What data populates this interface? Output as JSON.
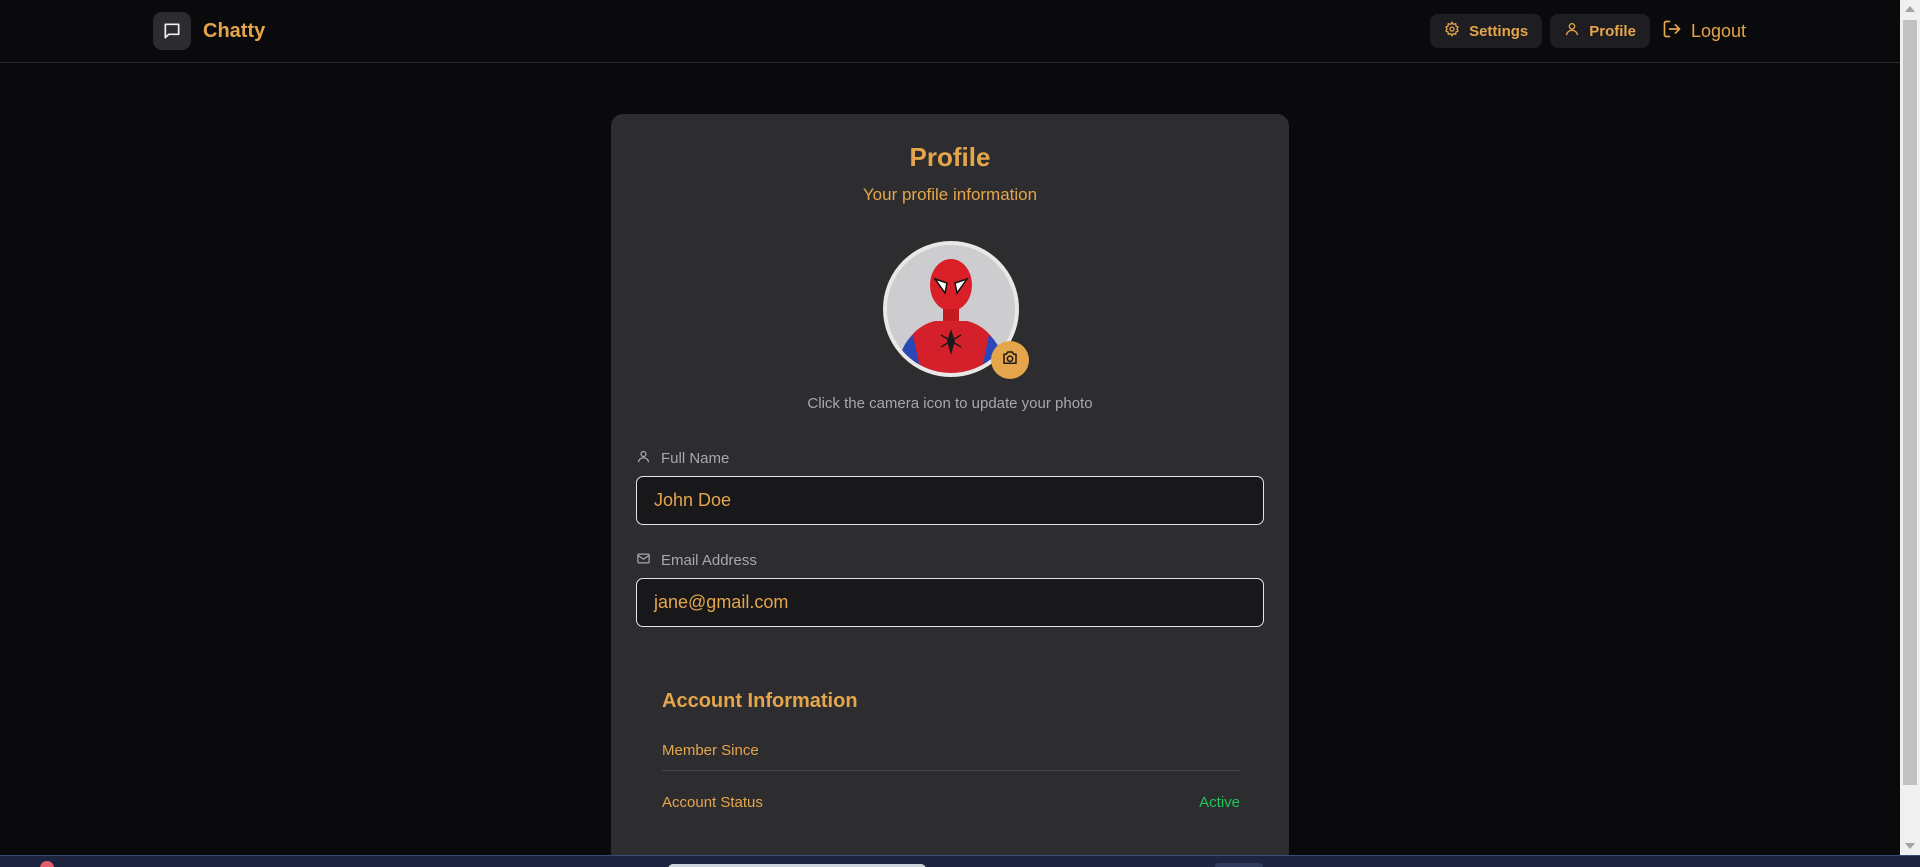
{
  "navbar": {
    "brand_name": "Chatty",
    "settings_label": "Settings",
    "profile_label": "Profile",
    "logout_label": "Logout"
  },
  "profile": {
    "title": "Profile",
    "subtitle": "Your profile information",
    "avatar_hint": "Click the camera icon to update your photo",
    "full_name_label": "Full Name",
    "full_name_value": "John Doe",
    "email_label": "Email Address",
    "email_value": "jane@gmail.com"
  },
  "account": {
    "title": "Account Information",
    "member_since_label": "Member Since",
    "member_since_value": "",
    "status_label": "Account Status",
    "status_value": "Active"
  },
  "colors": {
    "accent": "#e5a54a",
    "background": "#0a0a0c",
    "card": "#2d2d30",
    "status_active": "#22c55e"
  },
  "icons": [
    "message-square-icon",
    "gear-icon",
    "user-icon",
    "logout-icon",
    "camera-icon",
    "mail-icon"
  ]
}
